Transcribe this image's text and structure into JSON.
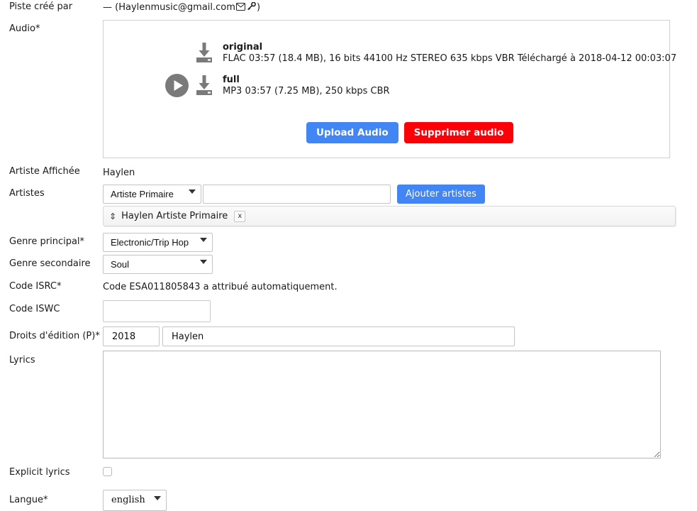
{
  "form": {
    "created_by": {
      "label": "Piste créé par",
      "value": "— (Haylenmusic@gmail.com",
      "mail_icon": "✉",
      "key_icon": "🔑",
      "suffix": ")"
    },
    "audio": {
      "label": "Audio*",
      "items": [
        {
          "name": "original",
          "description": "FLAC 03:57 (18.4 MB), 16 bits 44100 Hz STEREO 635 kbps VBR Téléchargé à 2018-04-12 00:03:07",
          "has_play": false,
          "play_icon": "play-circle-icon",
          "download_icon": "download-icon"
        },
        {
          "name": "full",
          "description": "MP3 03:57 (7.25 MB), 250 kbps CBR",
          "has_play": true,
          "play_icon": "play-circle-icon",
          "download_icon": "download-icon"
        }
      ],
      "upload_button": "Upload Audio",
      "delete_button": "Supprimer audio",
      "upload_color": "#4285f4",
      "delete_color": "#fb0007"
    },
    "display_artist": {
      "label": "Artiste Affichée",
      "value": "Haylen"
    },
    "artistes": {
      "label": "Artistes",
      "role_selected": "Artiste Primaire",
      "name_value": "",
      "name_placeholder": "",
      "add_button": "Ajouter artistes",
      "list": [
        {
          "drag_icon": "↕",
          "label": "Haylen Artiste Primaire",
          "remove_label": "x"
        }
      ]
    },
    "genre_principal": {
      "label": "Genre principal*",
      "value": "Electronic/Trip Hop"
    },
    "genre_secondaire": {
      "label": "Genre secondaire",
      "value": "Soul"
    },
    "code_isrc": {
      "label": "Code ISRC*",
      "value": "Code ESA011805843 a attribué automatiquement."
    },
    "code_iswc": {
      "label": "Code ISWC",
      "value": "",
      "placeholder": ""
    },
    "droits_edition": {
      "label": "Droits d'édition (P)*",
      "year": "2018",
      "owner": "Haylen"
    },
    "lyrics": {
      "label": "Lyrics",
      "value": "",
      "placeholder": ""
    },
    "explicit": {
      "label": "Explicit lyrics",
      "checked": false
    },
    "langue": {
      "label": "Langue*",
      "value": "english"
    }
  }
}
